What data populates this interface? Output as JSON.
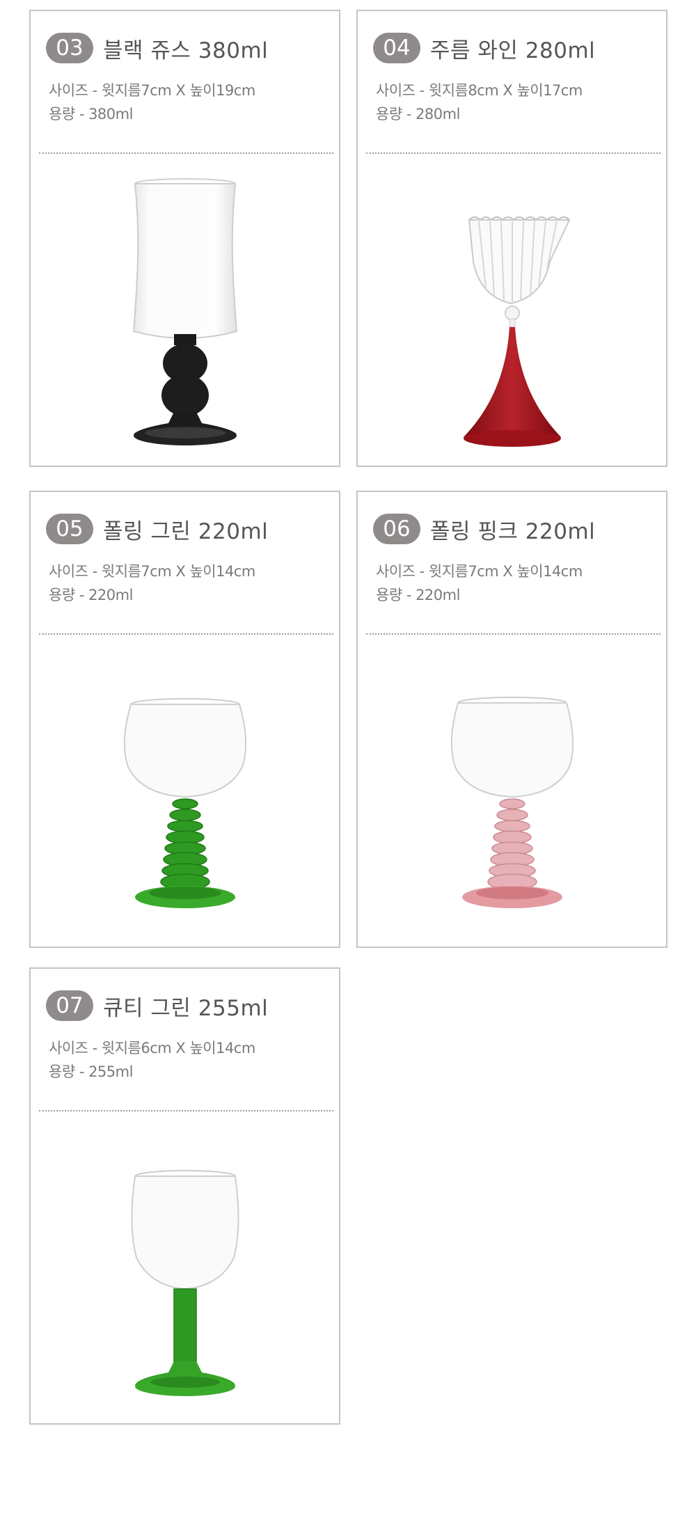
{
  "products": [
    {
      "number": "03",
      "name": "블랙 쥬스 380ml",
      "size": "사이즈 - 윗지름7cm X 높이19cm",
      "volume": "용량 - 380ml",
      "glass_icon": "black-juice-glass-icon",
      "accent": "#1b1b1b"
    },
    {
      "number": "04",
      "name": "주름 와인 280ml",
      "size": "사이즈 - 윗지름8cm X 높이17cm",
      "volume": "용량 - 280ml",
      "glass_icon": "wrinkle-wine-glass-icon",
      "accent": "#a3161c"
    },
    {
      "number": "05",
      "name": "폴링 그린 220ml",
      "size": "사이즈 - 윗지름7cm X 높이14cm",
      "volume": "용량 - 220ml",
      "glass_icon": "falling-green-glass-icon",
      "accent": "#2f9a22"
    },
    {
      "number": "06",
      "name": "폴링 핑크 220ml",
      "size": "사이즈 - 윗지름7cm X 높이14cm",
      "volume": "용량 - 220ml",
      "glass_icon": "falling-pink-glass-icon",
      "accent": "#d17a82"
    },
    {
      "number": "07",
      "name": "큐티 그린 255ml",
      "size": "사이즈 - 윗지름6cm X 높이14cm",
      "volume": "용량 - 255ml",
      "glass_icon": "cutie-green-glass-icon",
      "accent": "#2f9a22"
    }
  ]
}
